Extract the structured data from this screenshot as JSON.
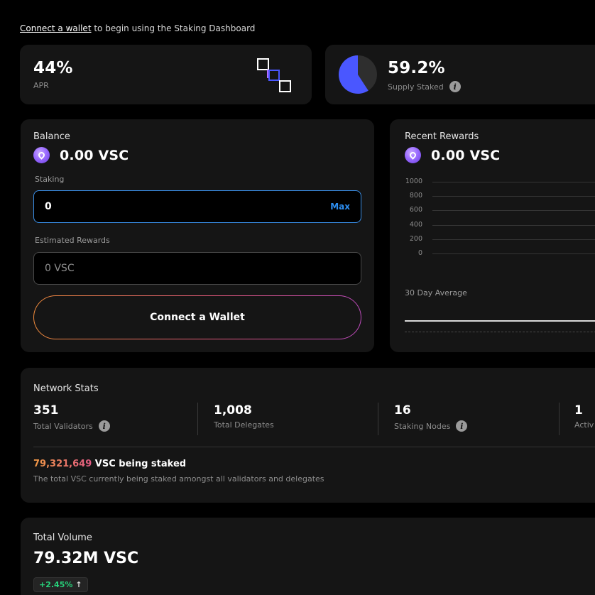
{
  "topline": {
    "link": "Connect a wallet",
    "rest": " to begin using the Staking Dashboard"
  },
  "apr_card": {
    "value": "44%",
    "label": "APR"
  },
  "supply_card": {
    "value": "59.2%",
    "label": "Supply Staked",
    "fraction": 0.592
  },
  "balance_card": {
    "title": "Balance",
    "amount": "0.00 VSC",
    "staking_label": "Staking",
    "staking_value": "0",
    "max_label": "Max",
    "est_label": "Estimated Rewards",
    "est_placeholder": "0 VSC",
    "connect_label": "Connect a Wallet"
  },
  "rewards_card": {
    "title": "Recent Rewards",
    "amount": "0.00 VSC",
    "y_ticks": [
      "1000",
      "800",
      "600",
      "400",
      "200",
      "0"
    ],
    "avg_label": "30 Day Average"
  },
  "network_stats": {
    "title": "Network Stats",
    "stats": [
      {
        "value": "351",
        "label": "Total Validators",
        "info": true
      },
      {
        "value": "1,008",
        "label": "Total Delegates",
        "info": false
      },
      {
        "value": "16",
        "label": "Staking Nodes",
        "info": true
      },
      {
        "value": "1",
        "label": "Activ",
        "info": false
      }
    ],
    "staked_number": "79,321,649",
    "staked_suffix": " VSC being staked",
    "staked_desc": "The total VSC currently being staked amongst all validators and delegates"
  },
  "volume_card": {
    "title": "Total Volume",
    "value": "79.32M VSC",
    "change": "+2.45%",
    "arrow": "↑"
  },
  "colors": {
    "accent_blue": "#3a8fe8",
    "pie_blue": "#4a57ff",
    "positive": "#27d07a"
  }
}
